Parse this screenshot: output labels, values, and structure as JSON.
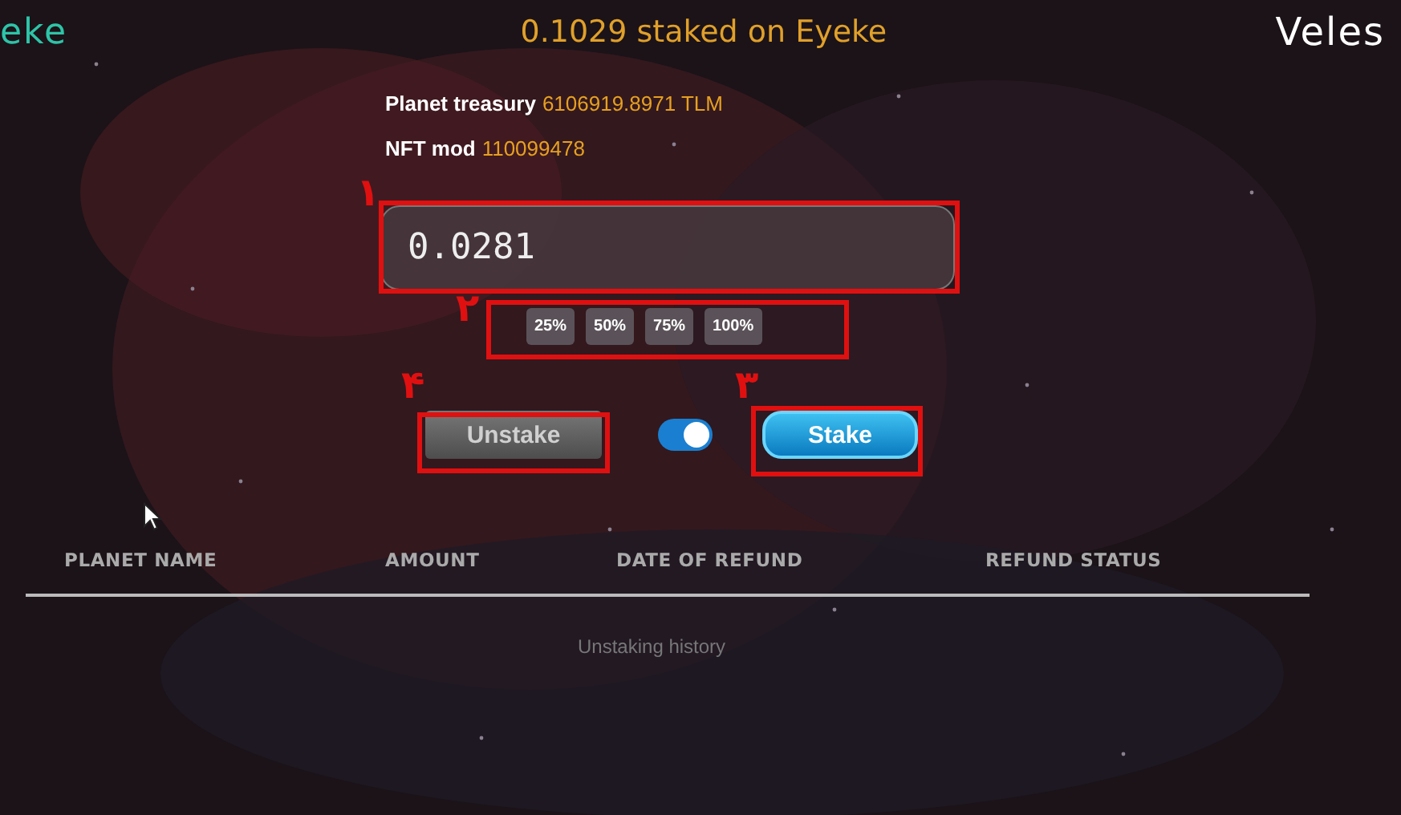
{
  "header": {
    "left_title": "eke",
    "title": "0.1029 staked on Eyeke",
    "right_title": "Veles"
  },
  "info": [
    {
      "label": "Planet treasury",
      "value": "6106919.8971 TLM"
    },
    {
      "label": "NFT mod",
      "value": "110099478"
    }
  ],
  "amount_field": {
    "value": "0.0281"
  },
  "percent_buttons": [
    "25%",
    "50%",
    "75%",
    "100%"
  ],
  "actions": [
    {
      "label": "Unstake",
      "kind": "secondary"
    },
    {
      "kind": "toggle",
      "on": true
    },
    {
      "label": "Stake",
      "kind": "primary"
    }
  ],
  "table": {
    "columns": [
      "PLANET NAME",
      "AMOUNT",
      "DATE OF REFUND",
      "REFUND STATUS"
    ],
    "empty_text": "Unstaking history"
  },
  "annotations": [
    {
      "label": "۱"
    },
    {
      "label": "۲"
    },
    {
      "label": "۳"
    },
    {
      "label": "۴"
    }
  ]
}
